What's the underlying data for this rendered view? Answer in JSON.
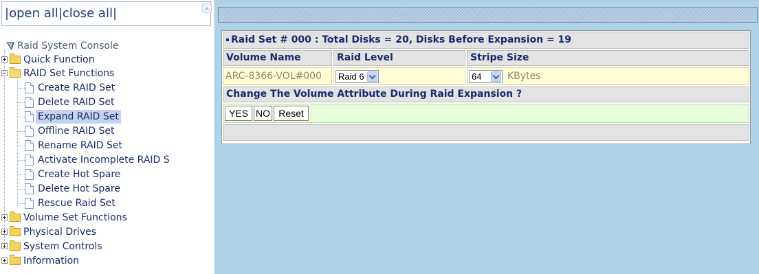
{
  "nav": {
    "bar_prefix": "|",
    "open_all": "open all",
    "separator": "|",
    "close_all": "close all",
    "bar_suffix": "|"
  },
  "tree": {
    "root": "Raid System Console",
    "quick_function": "Quick Function",
    "raid_set_functions": "RAID Set Functions",
    "raid_children": [
      "Create RAID Set",
      "Delete RAID Set",
      "Expand RAID Set",
      "Offline RAID Set",
      "Rename RAID Set",
      "Activate Incomplete RAID S",
      "Create Hot Spare",
      "Delete Hot Spare",
      "Rescue Raid Set"
    ],
    "selected": "Expand RAID Set",
    "volume_set_functions": "Volume Set Functions",
    "physical_drives": "Physical Drives",
    "system_controls": "System Controls",
    "information": "Information"
  },
  "panel": {
    "title": "Raid Set # 000 : Total Disks = 20, Disks Before Expansion = 19",
    "headers": [
      "Volume Name",
      "Raid Level",
      "Stripe Size"
    ],
    "volume_name": "ARC-8366-VOL#000",
    "raid_level": "Raid 6",
    "stripe_size": "64",
    "stripe_unit": "KBytes",
    "change_prompt": "Change The Volume Attribute During Raid Expansion ?",
    "buttons": {
      "yes": "YES",
      "no": "NO",
      "reset": "Reset"
    }
  },
  "colors": {
    "right_bg": "#b0d2e7",
    "header_gray": "#e3e3e3",
    "data_row": "#fffcd6",
    "button_row": "#e6fbd8",
    "text_navy": "#1a2a6a",
    "muted_value": "#8a8a6a"
  }
}
